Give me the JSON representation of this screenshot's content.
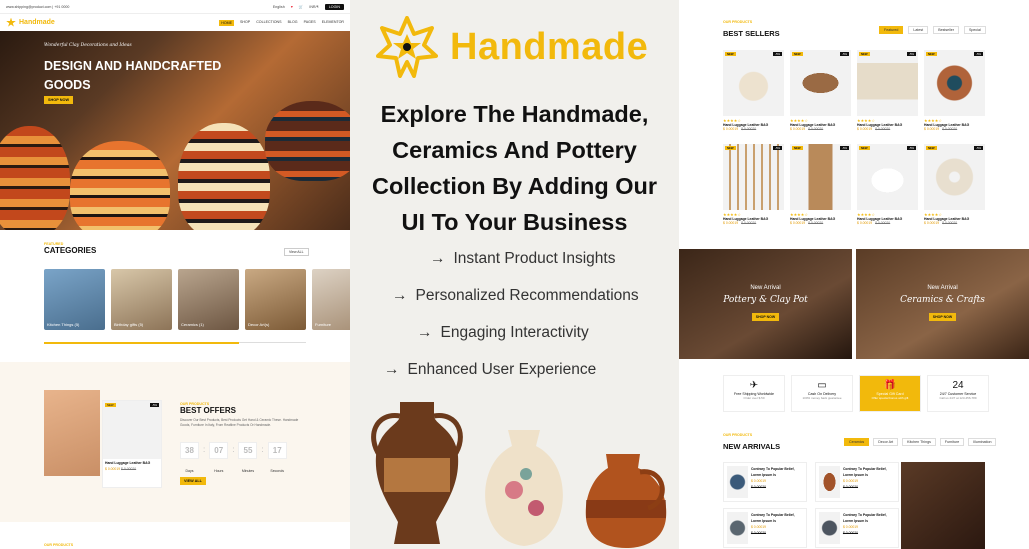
{
  "left": {
    "topbar": {
      "email": "www.shipping@product.com | +91 0000",
      "language": "English",
      "currency": "INR/₹",
      "login": "LOGIN"
    },
    "nav": {
      "brand": "Handmade",
      "menu": [
        "HOME",
        "SHOP",
        "COLLECTIONS",
        "BLOG",
        "PAGES",
        "ELEMENTOR"
      ]
    },
    "hero": {
      "tagline": "Wonderful Clay Decorations and Ideas",
      "title": "DESIGN AND HANDCRAFTED GOODS",
      "cta": "SHOP NOW"
    },
    "categories": {
      "label": "FEATURED",
      "title": "CATEGORIES",
      "view_all": "View ALL",
      "items": [
        {
          "name": "Kitchen Things (5)"
        },
        {
          "name": "Birthday gifts (5)"
        },
        {
          "name": "Ceramics (1)"
        },
        {
          "name": "Decor Art(s)"
        },
        {
          "name": "Furniture"
        }
      ]
    },
    "offers": {
      "label": "OUR PRODUCTS",
      "title": "BEST OFFERS",
      "desc": "Discover Our Best Products, Best Products Get Hand & Ceramic These. Handmade Goods, Furniture In Italy, From Realtine Products Or Handmade.",
      "card": {
        "name": "Hand Luggage Leather BAG",
        "price": "$ 0.00019",
        "old": "$ 0.00020",
        "new": "NEW",
        "off": "-5%"
      },
      "timer": [
        {
          "v": "38",
          "l": "Days"
        },
        {
          "v": "07",
          "l": "Hours"
        },
        {
          "v": "55",
          "l": "Minutes"
        },
        {
          "v": "17",
          "l": "Seconds"
        }
      ],
      "cta": "VIEW ALL"
    },
    "footer_label": "OUR PRODUCTS"
  },
  "mid": {
    "brand": "Handmade",
    "headline": "Explore The Handmade, Ceramics And Pottery Collection By Adding Our UI To Your Business",
    "features": [
      "Instant Product Insights",
      "Personalized Recommendations",
      "Engaging Interactivity",
      "Enhanced User Experience"
    ],
    "arrow": "→",
    "colors": {
      "accent": "#f2b90c",
      "bg": "#f1f0ec"
    }
  },
  "right": {
    "best": {
      "label": "OUR PRODUCTS",
      "title": "BEST SELLERS",
      "tabs": [
        "Featured",
        "Latest",
        "Bestseller",
        "Special"
      ],
      "products": [
        {
          "name": "Hand Luggage Leather BAG",
          "price": "$ 0.00019",
          "old": "$ 0.00020",
          "stars": "★★★★☆",
          "new": "NEW",
          "off": "-5%"
        },
        {
          "name": "Hand Luggage Leather BAG",
          "price": "$ 0.00019",
          "old": "$ 0.00020",
          "stars": "★★★★☆",
          "new": "NEW",
          "off": "-5%"
        },
        {
          "name": "Hand Luggage Leather BAG",
          "price": "$ 0.00019",
          "old": "$ 0.00020",
          "stars": "★★★★☆",
          "new": "NEW",
          "off": "-5%"
        },
        {
          "name": "Hand Luggage Leather BAG",
          "price": "$ 0.00019",
          "old": "$ 0.00020",
          "stars": "★★★★☆",
          "new": "NEW",
          "off": "-5%"
        },
        {
          "name": "Hand Luggage Leather BAG",
          "price": "$ 0.00019",
          "old": "$ 0.00020",
          "stars": "★★★★☆",
          "new": "NEW",
          "off": "-5%"
        },
        {
          "name": "Hand Luggage Leather BAG",
          "price": "$ 0.00019",
          "old": "$ 0.00020",
          "stars": "★★★★☆",
          "new": "NEW",
          "off": "-5%"
        },
        {
          "name": "Hand Luggage Leather BAG",
          "price": "$ 0.00019",
          "old": "$ 0.00020",
          "stars": "★★★★☆",
          "new": "NEW",
          "off": "-5%"
        },
        {
          "name": "Hand Luggage Leather BAG",
          "price": "$ 0.00019",
          "old": "$ 0.00020",
          "stars": "★★★★☆",
          "new": "NEW",
          "off": "-5%"
        }
      ]
    },
    "banners": [
      {
        "label": "New Arrival",
        "title": "Pottery & Clay Pot",
        "cta": "SHOP NOW"
      },
      {
        "label": "New Arrival",
        "title": "Ceramics & Crafts",
        "cta": "SHOP NOW"
      }
    ],
    "services": [
      {
        "icon": "plane-icon",
        "glyph": "✈",
        "title": "Free Shipping Worldwide",
        "sub": "Order over $.50"
      },
      {
        "icon": "wallet-icon",
        "glyph": "▭",
        "title": "Cash On Delivery",
        "sub": "100% money back guarantee"
      },
      {
        "icon": "gift-icon",
        "glyph": "🎁",
        "title": "Special Gift Card",
        "sub": "Offer special bonus with gift"
      },
      {
        "icon": "support-icon",
        "glyph": "24",
        "title": "24/7 Customer Service",
        "sub": "Call us 24/7 at 123-456-789"
      }
    ],
    "arrivals": {
      "label": "OUR PRODUCTS",
      "title": "NEW ARRIVALS",
      "tabs": [
        "Ceramics",
        "Decor Art",
        "Kitchen Things",
        "Furniture",
        "Illumination"
      ],
      "items": [
        {
          "name": "Contrary To Popular Belief, Lorem Ipsum Is",
          "price": "$ 0.00019",
          "old": "$ 0.00020"
        },
        {
          "name": "Contrary To Popular Belief, Lorem Ipsum Is",
          "price": "$ 0.00019",
          "old": "$ 0.00020"
        },
        {
          "name": "Contrary To Popular Belief, Lorem Ipsum Is",
          "price": "$ 0.00019",
          "old": "$ 0.00020"
        },
        {
          "name": "Contrary To Popular Belief, Lorem Ipsum Is",
          "price": "$ 0.00019",
          "old": "$ 0.00020"
        }
      ]
    }
  }
}
